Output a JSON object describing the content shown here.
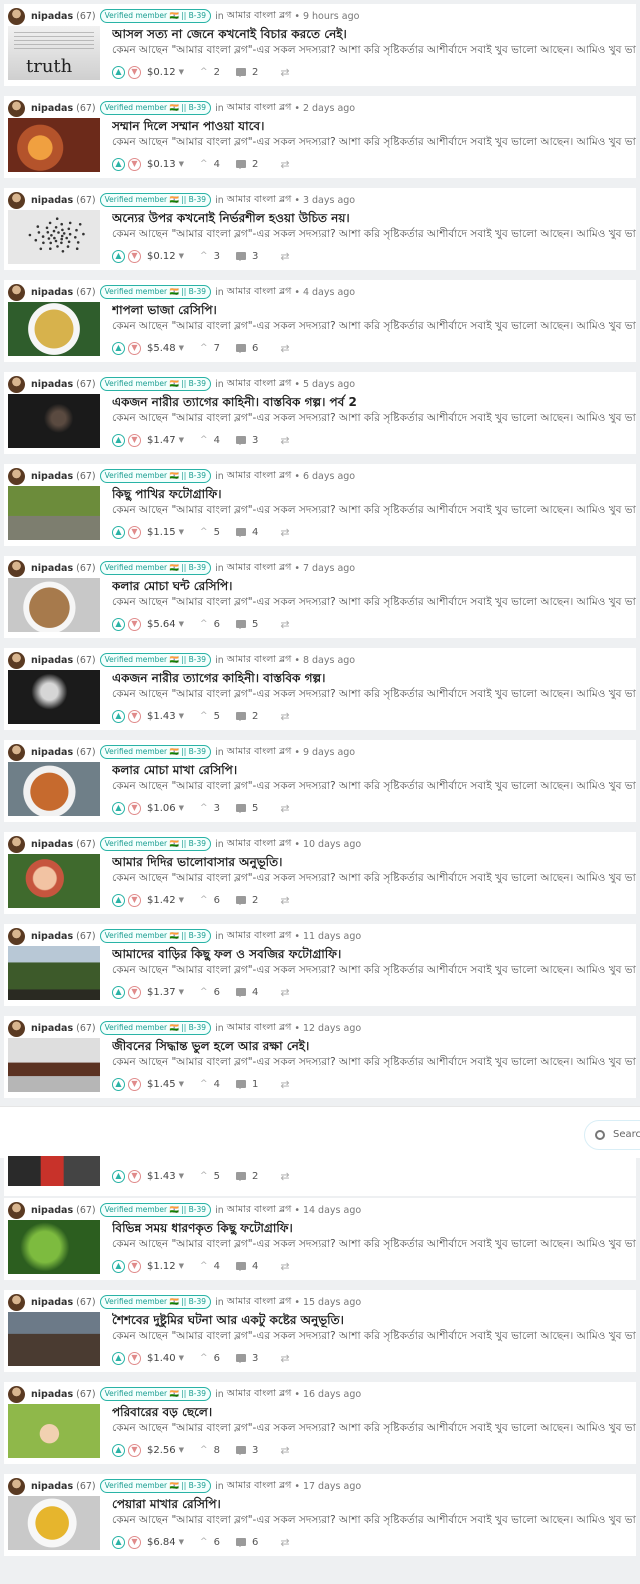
{
  "common": {
    "author": "nipadas",
    "reputation": "(67)",
    "badge": "Verified member 🇮🇳 || B-39",
    "in_word": "in",
    "community": "আমার বাংলা ব্লগ",
    "excerpt": "কেমন আছেন \"আমার বাংলা ব্লগ\"-এর সকল সদস্যরা? আশা করি সৃষ্টিকর্তার আশীর্বাদে সবাই খুব ভালো আছেন। আমিও খুব ভালো আছি।"
  },
  "search": {
    "placeholder": "Searc"
  },
  "partial_post": {
    "payout": "$1.43",
    "votes": "5",
    "comments": "2"
  },
  "posts": [
    {
      "age": "9 hours ago",
      "title": "আসল সত্য না জেনে কখনোই বিচার করতে নেই।",
      "payout": "$0.12",
      "votes": "2",
      "comments": "2",
      "thumb": "t-paper",
      "thumb_icon": "newspaper-truth-image",
      "thumb_text": "truth"
    },
    {
      "age": "2 days ago",
      "title": "সম্মান দিলে সম্মান পাওয়া যাবে।",
      "payout": "$0.13",
      "votes": "4",
      "comments": "2",
      "thumb": "t-warm",
      "thumb_icon": "people-image"
    },
    {
      "age": "3 days ago",
      "title": "অন্যের উপর কখনোই নির্ভরশীল হওয়া উচিত নয়।",
      "payout": "$0.12",
      "votes": "3",
      "comments": "3",
      "thumb": "t-dots",
      "thumb_icon": "ants-image"
    },
    {
      "age": "4 days ago",
      "title": "শাপলা ভাজা রেসিপি।",
      "payout": "$5.48",
      "votes": "7",
      "comments": "6",
      "thumb": "t-food1",
      "thumb_icon": "food-image"
    },
    {
      "age": "5 days ago",
      "title": "একজন নারীর ত্যাগের কাহিনী। বাস্তবিক গল্প। পর্ব 2",
      "payout": "$1.47",
      "votes": "4",
      "comments": "3",
      "thumb": "t-dark",
      "thumb_icon": "woman-portrait-image"
    },
    {
      "age": "6 days ago",
      "title": "কিছু পাখির ফটোগ্রাফি।",
      "payout": "$1.15",
      "votes": "5",
      "comments": "4",
      "thumb": "t-green",
      "thumb_icon": "birds-image"
    },
    {
      "age": "7 days ago",
      "title": "কলার মোচা ঘন্ট রেসিপি।",
      "payout": "$5.64",
      "votes": "6",
      "comments": "5",
      "thumb": "t-food2",
      "thumb_icon": "food-image"
    },
    {
      "age": "8 days ago",
      "title": "একজন নারীর ত্যাগের কাহিনী। বাস্তবিক গল্প।",
      "payout": "$1.43",
      "votes": "5",
      "comments": "2",
      "thumb": "t-bw",
      "thumb_icon": "woman-portrait-image"
    },
    {
      "age": "9 days ago",
      "title": "কলার মোচা মাখা রেসিপি।",
      "payout": "$1.06",
      "votes": "3",
      "comments": "5",
      "thumb": "t-food3",
      "thumb_icon": "food-image"
    },
    {
      "age": "10 days ago",
      "title": "আমার দিদির ভালোবাসার অনুভূতি।",
      "payout": "$1.42",
      "votes": "6",
      "comments": "2",
      "thumb": "t-kids",
      "thumb_icon": "children-image"
    },
    {
      "age": "11 days ago",
      "title": "আমাদের বাড়ির কিছু ফল ও সবজির ফটোগ্রাফি।",
      "payout": "$1.37",
      "votes": "6",
      "comments": "4",
      "thumb": "t-trees",
      "thumb_icon": "trees-image"
    },
    {
      "age": "12 days ago",
      "title": "জীবনের সিদ্ধান্ত ভুল হলে আর রক্ষা নেই।",
      "payout": "$1.45",
      "votes": "4",
      "comments": "1",
      "thumb": "t-gavel",
      "thumb_icon": "gavel-image"
    },
    {
      "age": "14 days ago",
      "title": "বিভিন্ন সময় ধারণকৃত কিছু ফটোগ্রাফি।",
      "payout": "$1.12",
      "votes": "4",
      "comments": "4",
      "thumb": "t-leaves",
      "thumb_icon": "plants-image"
    },
    {
      "age": "15 days ago",
      "title": "শৈশবের দুষ্টুমির ঘটনা আর একটু কষ্টের অনুভূতি।",
      "payout": "$1.40",
      "votes": "6",
      "comments": "3",
      "thumb": "t-kids2",
      "thumb_icon": "children-image"
    },
    {
      "age": "16 days ago",
      "title": "পরিবারের বড় ছেলে।",
      "payout": "$2.56",
      "votes": "8",
      "comments": "3",
      "thumb": "t-baby",
      "thumb_icon": "baby-image"
    },
    {
      "age": "17 days ago",
      "title": "পেয়ারা মাখার রেসিপি।",
      "payout": "$6.84",
      "votes": "6",
      "comments": "6",
      "thumb": "t-food4",
      "thumb_icon": "food-image"
    }
  ]
}
